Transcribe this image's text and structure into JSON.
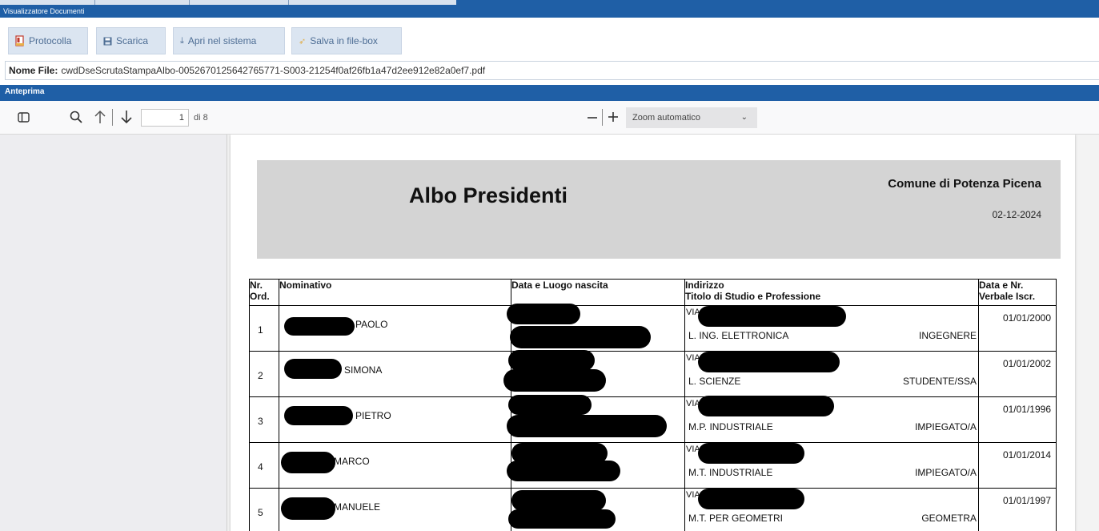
{
  "window": {
    "title": "Visualizzatore Documenti"
  },
  "toolbar": {
    "protocolla": "Protocolla",
    "scarica": "Scarica",
    "apri": "Apri nel sistema",
    "salva": "Salva in file-box"
  },
  "file": {
    "label": "Nome File:",
    "name": "cwdDseScrutaStampaAlbo-0052670125642765771-S003-21254f0af26fb1a47d2ee912e82a0ef7.pdf"
  },
  "preview": {
    "section_title": "Anteprima"
  },
  "pdf_toolbar": {
    "page_current": "1",
    "page_total": "di 8",
    "zoom_value": "Zoom automatico",
    "icons": [
      "sidebar-toggle-icon",
      "search-icon",
      "arrow-up-icon",
      "arrow-down-icon",
      "zoom-out-icon",
      "zoom-in-icon",
      "chevron-down-icon"
    ]
  },
  "document": {
    "title": "Albo Presidenti",
    "comune": "Comune di Potenza Picena",
    "date": "02-12-2024",
    "table": {
      "headers": {
        "nr": [
          "Nr.",
          "Ord."
        ],
        "nominativo": "Nominativo",
        "data_luogo": "Data e Luogo nascita",
        "indirizzo": [
          "Indirizzo",
          "Titolo di Studio e Professione"
        ],
        "verbale": [
          "Data e Nr.",
          "Verbale Iscr."
        ]
      },
      "rows": [
        {
          "nr": "1",
          "name": "PAOLO",
          "via": "VIA",
          "titolo": "L. ING. ELETTRONICA",
          "professione": "INGEGNERE",
          "verbale": "01/01/2000"
        },
        {
          "nr": "2",
          "name": "SIMONA",
          "via": "VIA",
          "titolo": "L. SCIENZE",
          "professione": "STUDENTE/SSA",
          "verbale": "01/01/2002"
        },
        {
          "nr": "3",
          "name": "PIETRO",
          "via": "VIA",
          "titolo": "M.P. INDUSTRIALE",
          "professione": "IMPIEGATO/A",
          "verbale": "01/01/1996"
        },
        {
          "nr": "4",
          "name": "MARCO",
          "via": "VIA",
          "titolo": "M.T. INDUSTRIALE",
          "professione": "IMPIEGATO/A",
          "verbale": "01/01/2014"
        },
        {
          "nr": "5",
          "name": "MANUELE",
          "via": "VIA",
          "titolo": "M.T. PER GEOMETRI",
          "professione": "GEOMETRA",
          "verbale": "01/01/1997"
        }
      ]
    }
  },
  "colors": {
    "header_blue": "#1f5fa6",
    "button_bg": "#dbe5f1",
    "button_text": "#4d6d94",
    "doc_header_gray": "#d4d4d4"
  }
}
